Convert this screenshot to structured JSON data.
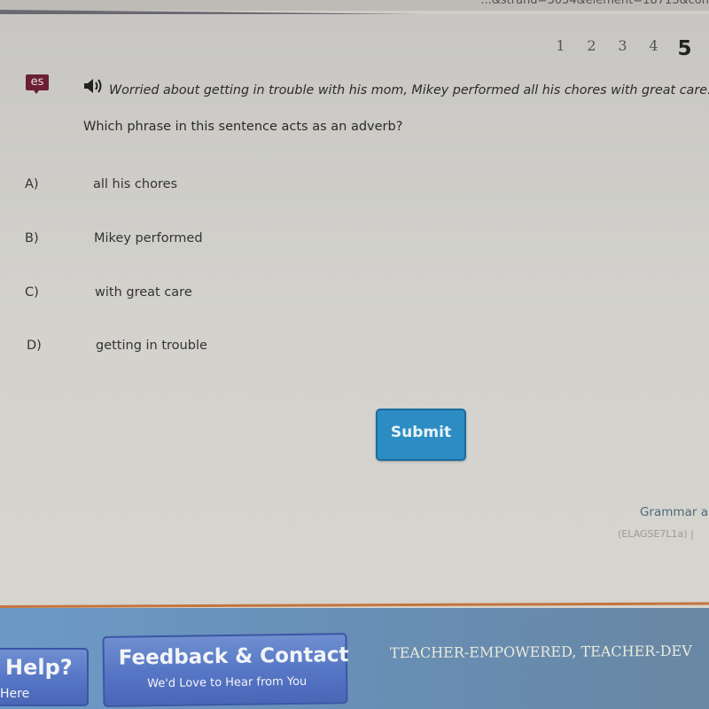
{
  "browser": {
    "url_fragment": "...&strand=3054&element=18713&con"
  },
  "pager": {
    "pages": [
      "1",
      "2",
      "3",
      "4",
      "5"
    ],
    "current": "5"
  },
  "question": {
    "lang_badge": "es",
    "speaker_icon": "speaker-icon",
    "sentence": "Worried about getting in trouble with his mom, Mikey performed all his chores with great care.",
    "prompt": "Which phrase in this sentence acts as an adverb?",
    "choices": [
      {
        "letter": "A)",
        "text": "all his chores"
      },
      {
        "letter": "B)",
        "text": "Mikey performed"
      },
      {
        "letter": "C)",
        "text": "with great care"
      },
      {
        "letter": "D)",
        "text": "getting in trouble"
      }
    ],
    "submit_label": "Submit"
  },
  "standard": {
    "title": "Grammar a",
    "code": "(ELAGSE7L1a) |"
  },
  "footer": {
    "help_title": "Help?",
    "help_sub": "Here",
    "feedback_title": "Feedback & Contact",
    "feedback_sub": "We'd Love to Hear from You",
    "tagline": "TEACHER-EMPOWERED, TEACHER-DEV"
  },
  "colors": {
    "submit": "#2d8dc2",
    "badge": "#6b1f35",
    "footer": "#6a8fb5",
    "accent_line": "#c3753e"
  }
}
